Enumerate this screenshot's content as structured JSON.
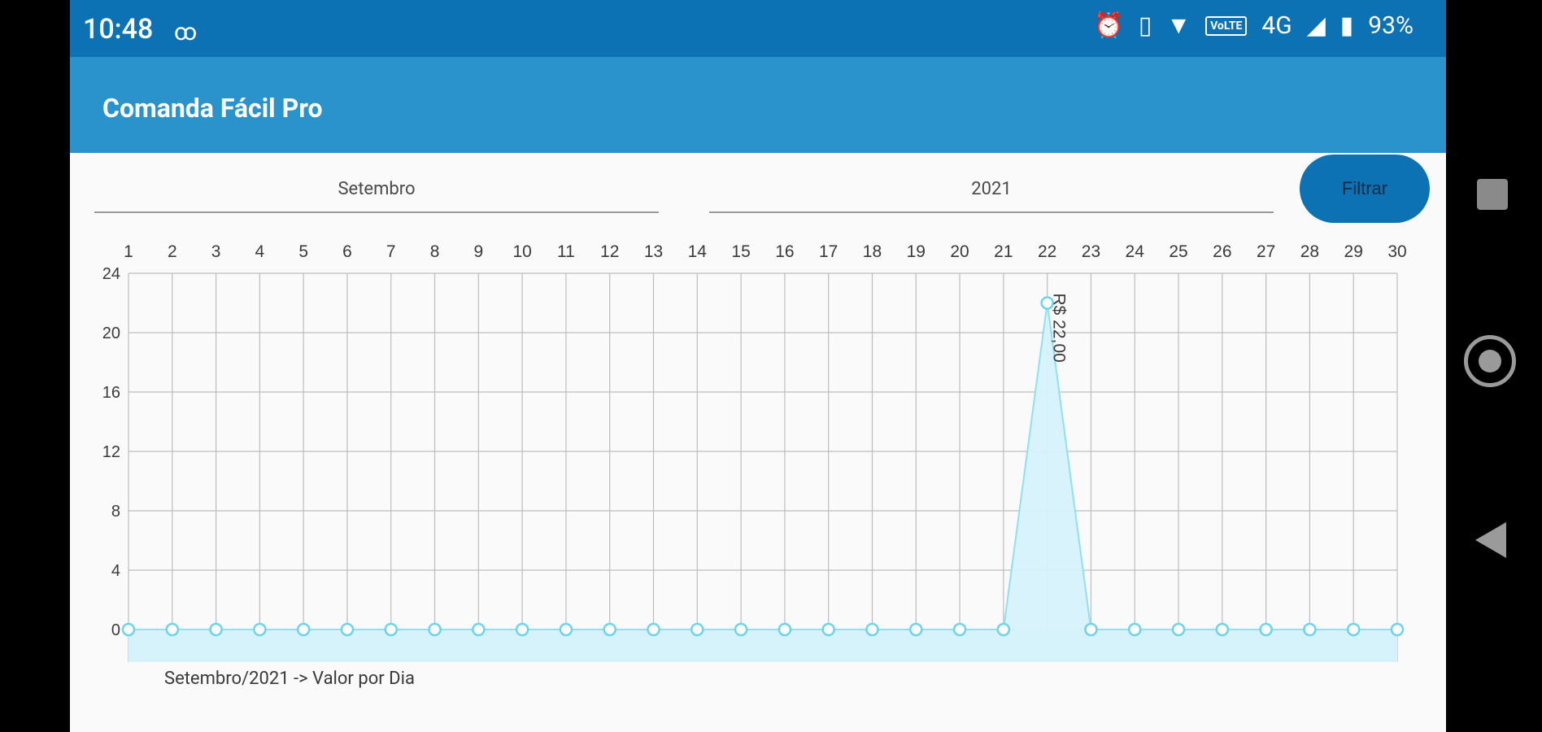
{
  "status_bar": {
    "time": "10:48",
    "icons": [
      "voicemail-icon",
      "alarm-icon",
      "vibrate-icon",
      "wifi-icon",
      "volte-icon",
      "signal-icon",
      "battery-icon"
    ],
    "volte_text": "VoLTE",
    "network": "4G",
    "battery": "93%"
  },
  "app_bar": {
    "title": "Comanda Fácil Pro"
  },
  "filters": {
    "month": "Setembro",
    "year": "2021",
    "button_label": "Filtrar"
  },
  "chart_caption": "Setembro/2021 -> Valor por Dia",
  "chart_data": {
    "type": "area",
    "categories": [
      "1",
      "2",
      "3",
      "4",
      "5",
      "6",
      "7",
      "8",
      "9",
      "10",
      "11",
      "12",
      "13",
      "14",
      "15",
      "16",
      "17",
      "18",
      "19",
      "20",
      "21",
      "22",
      "23",
      "24",
      "25",
      "26",
      "27",
      "28",
      "29",
      "30"
    ],
    "values": [
      0,
      0,
      0,
      0,
      0,
      0,
      0,
      0,
      0,
      0,
      0,
      0,
      0,
      0,
      0,
      0,
      0,
      0,
      0,
      0,
      0,
      22,
      0,
      0,
      0,
      0,
      0,
      0,
      0,
      0
    ],
    "yticks": [
      0,
      4,
      8,
      12,
      16,
      20,
      24
    ],
    "ylim": [
      0,
      24
    ],
    "xaxis_position": "top",
    "grid": true,
    "annotations": [
      {
        "x": "22",
        "label": "R$ 22,00"
      }
    ],
    "colors": {
      "line": "#8fdff5",
      "fill": "#d6f2fb",
      "grid": "#bdbdbd",
      "marker": "#6cd3ef"
    }
  }
}
